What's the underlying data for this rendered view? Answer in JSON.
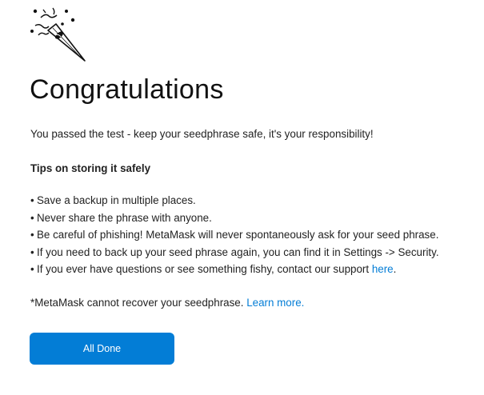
{
  "icons": {
    "confetti": "party-popper-icon"
  },
  "colors": {
    "accent": "#037dd6",
    "text": "#222222",
    "button_text": "#ffffff"
  },
  "header": {
    "title": "Congratulations"
  },
  "content": {
    "passed_text": "You passed the test - keep your seedphrase safe, it's your responsibility!",
    "tips_heading": "Tips on storing it safely",
    "bullet": "•",
    "tips": [
      "Save a backup in multiple places.",
      "Never share the phrase with anyone.",
      "Be careful of phishing! MetaMask will never spontaneously ask for your seed phrase.",
      "If you need to back up your seed phrase again, you can find it in Settings -> Security."
    ],
    "support_tip_prefix": "If you ever have questions or see something fishy, contact our support ",
    "support_link": "here",
    "support_tip_suffix": ".",
    "recover_text": "*MetaMask cannot recover your seedphrase. ",
    "learn_more_link": "Learn more."
  },
  "actions": {
    "done_label": "All Done"
  }
}
